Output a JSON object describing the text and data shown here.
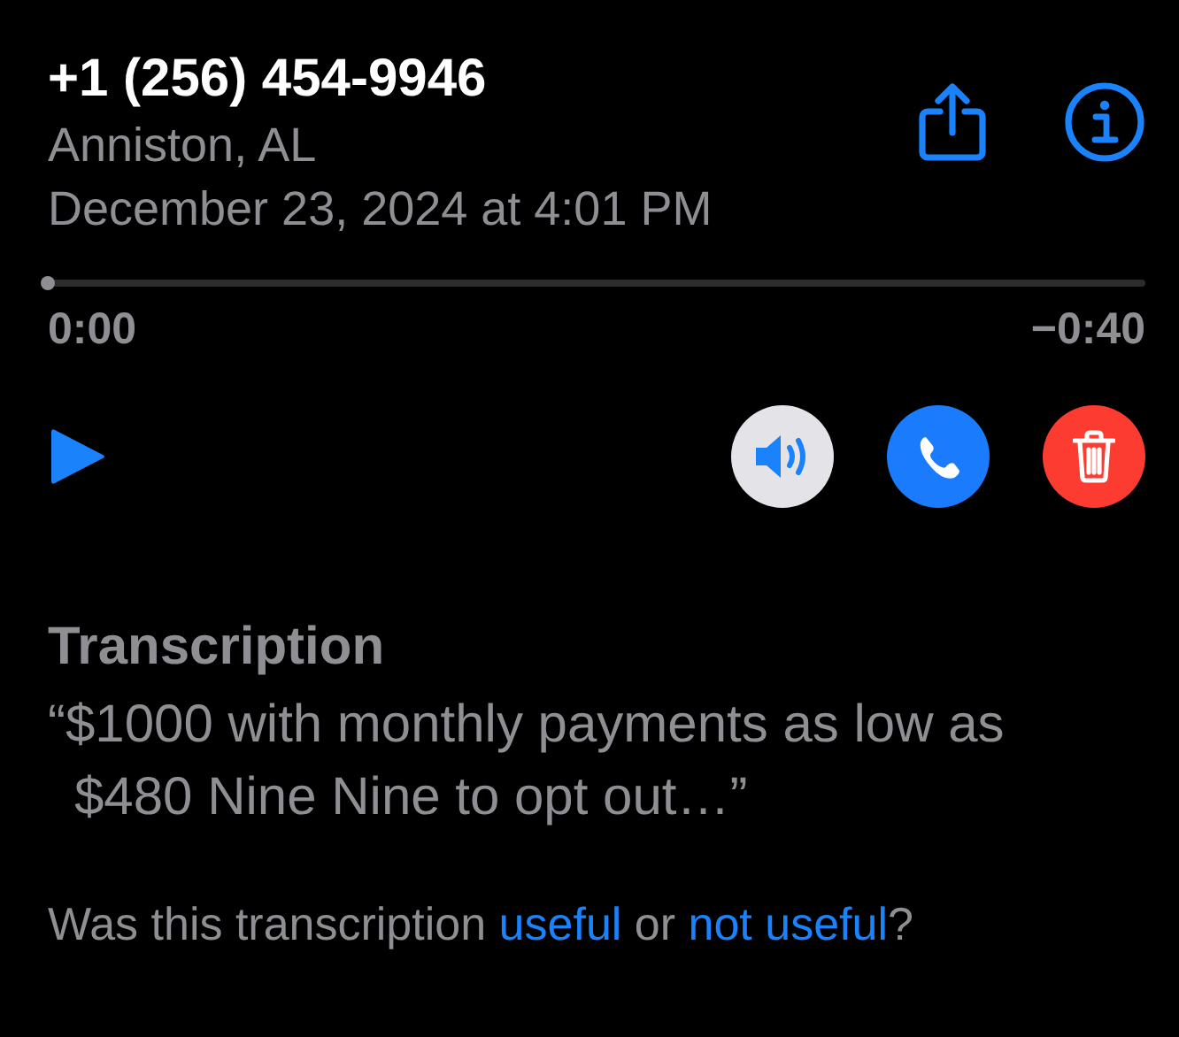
{
  "header": {
    "phone": "+1 (256) 454-9946",
    "location": "Anniston, AL",
    "date": "December 23, 2024 at 4:01 PM"
  },
  "player": {
    "level": 0,
    "elapsed": "0:00",
    "remaining": "−0:40"
  },
  "actions": [
    {
      "kind": "speaker"
    },
    {
      "kind": "call"
    },
    {
      "kind": "delete"
    }
  ],
  "transcription": {
    "heading": "Transcription",
    "text": "“$1000 with monthly payments as low as $480 Nine Nine to opt out…”"
  },
  "feedback": [
    {
      "kind": "text",
      "text": "Was this transcription "
    },
    {
      "kind": "link",
      "text": "useful"
    },
    {
      "kind": "text",
      "text": " or "
    },
    {
      "kind": "link",
      "text": "not useful"
    },
    {
      "kind": "text",
      "text": "?"
    }
  ]
}
